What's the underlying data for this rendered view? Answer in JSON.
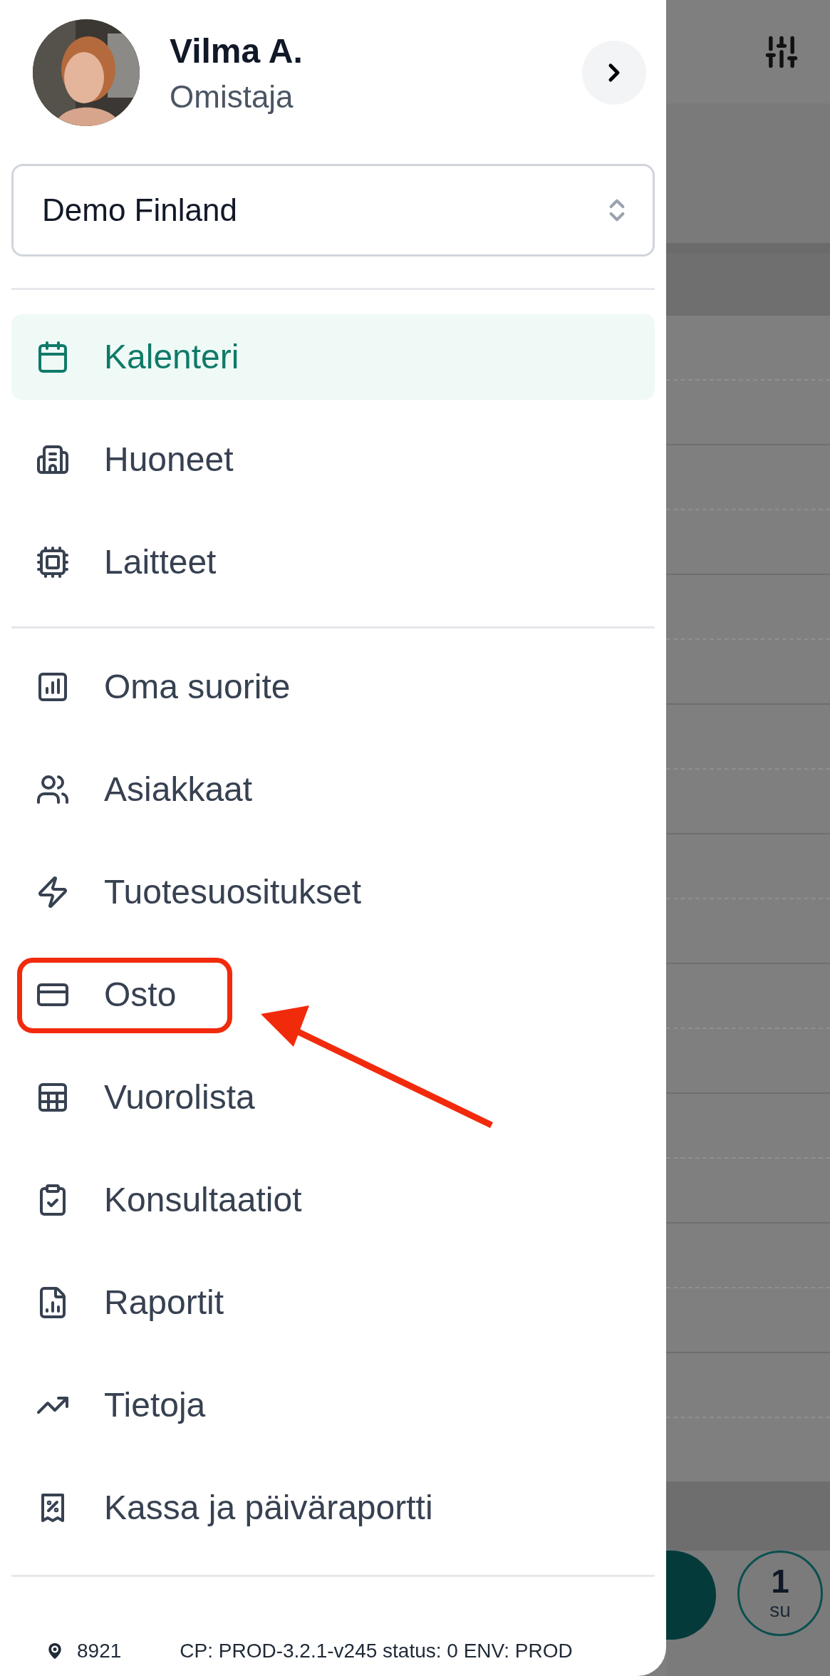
{
  "profile": {
    "name": "Vilma A.",
    "role": "Omistaja"
  },
  "organization_select": {
    "value": "Demo Finland"
  },
  "menu_sections": [
    {
      "items": [
        {
          "label": "Kalenteri",
          "selected": true
        },
        {
          "label": "Huoneet",
          "selected": false
        },
        {
          "label": "Laitteet",
          "selected": false
        }
      ]
    },
    {
      "items": [
        {
          "label": "Oma suorite",
          "selected": false
        },
        {
          "label": "Asiakkaat",
          "selected": false
        },
        {
          "label": "Tuotesuositukset",
          "selected": false
        },
        {
          "label": "Osto",
          "selected": false,
          "highlighted": true
        },
        {
          "label": "Vuorolista",
          "selected": false
        },
        {
          "label": "Konsultaatiot",
          "selected": false
        },
        {
          "label": "Raportit",
          "selected": false
        },
        {
          "label": "Tietoja",
          "selected": false
        },
        {
          "label": "Kassa ja päiväraportti",
          "selected": false
        }
      ]
    }
  ],
  "footer": {
    "location": "8921",
    "build": "CP: PROD-3.2.1-v245 status: 0 ENV: PROD"
  },
  "background": {
    "day_number": "1",
    "weekday": "su"
  }
}
